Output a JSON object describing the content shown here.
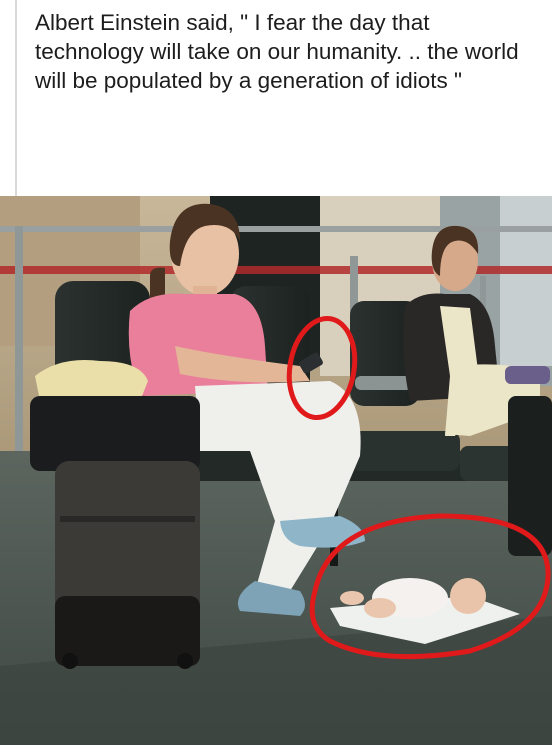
{
  "post": {
    "caption": "Albert Einstein said, \" I fear the day that technology will take on our humanity. .. the world will be populated by a generation of idiots \""
  },
  "photo": {
    "annotation_color": "#e01a1a",
    "annotations": [
      "phone-circle",
      "baby-circle"
    ]
  }
}
